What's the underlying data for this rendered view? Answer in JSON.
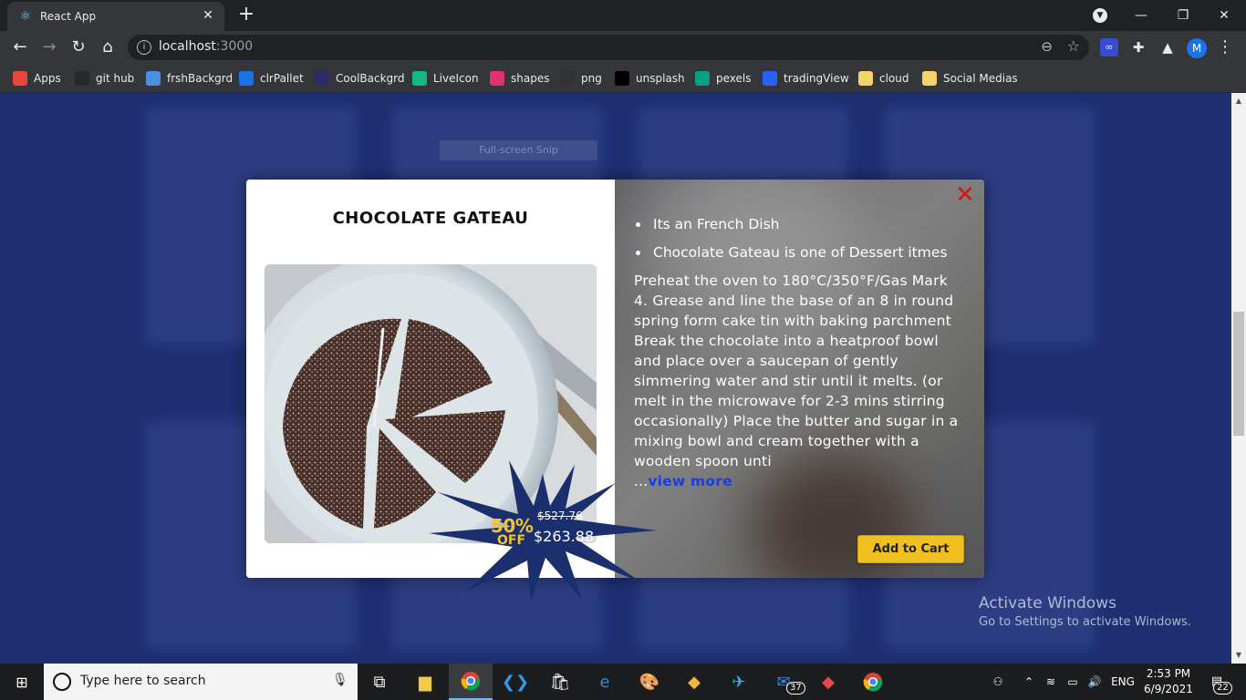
{
  "browser": {
    "tab_title": "React App",
    "tab_close": "✕",
    "new_tab": "+",
    "url_host": "localhost",
    "url_port": ":3000",
    "profile_initial": "M",
    "bookmarks": [
      {
        "label": "Apps",
        "icon": "apps-grid-icon",
        "color": "#e8453c"
      },
      {
        "label": "git hub",
        "icon": "github-icon",
        "color": "#24292e"
      },
      {
        "label": "frshBackgrd",
        "icon": "globe-icon",
        "color": "#4a90e2"
      },
      {
        "label": "clrPallet",
        "icon": "palette-icon",
        "color": "#1a73e8"
      },
      {
        "label": "CoolBackgrd",
        "icon": "coolbackgrounds-icon",
        "color": "#2a2e66"
      },
      {
        "label": "LiveIcon",
        "icon": "liveicon-icon",
        "color": "#12b886"
      },
      {
        "label": "shapes",
        "icon": "shapes-icon",
        "color": "#e03170"
      },
      {
        "label": "png",
        "icon": "png-icon",
        "color": "#333333"
      },
      {
        "label": "unsplash",
        "icon": "unsplash-icon",
        "color": "#000000"
      },
      {
        "label": "pexels",
        "icon": "pexels-icon",
        "color": "#05a081"
      },
      {
        "label": "tradingView",
        "icon": "tradingview-icon",
        "color": "#2962ff"
      },
      {
        "label": "cloud",
        "icon": "folder-icon",
        "color": "#f4d36b"
      },
      {
        "label": "Social Medias",
        "icon": "folder-icon",
        "color": "#f4d36b"
      }
    ]
  },
  "page": {
    "snip_label": "Full-screen Snip"
  },
  "modal": {
    "title": "CHOCOLATE GATEAU",
    "close_symbol": "✕",
    "bullets": [
      "Its an French Dish",
      "Chocolate Gateau is one of Dessert itmes"
    ],
    "recipe": "Preheat the oven to 180°C/350°F/Gas Mark 4. Grease and line the base of an 8 in round spring form cake tin with baking parchment Break the chocolate into a heatproof bowl and place over a saucepan of gently simmering water and stir until it melts. (or melt in the microwave for 2-3 mins stirring occasionally) Place the butter and sugar in a mixing bowl and cream together with a wooden spoon unti",
    "recipe_ellipsis": "...",
    "view_more": "view more",
    "add_to_cart": "Add to Cart",
    "discount_pct": "50%",
    "discount_off": "OFF",
    "old_price": "$527.76",
    "new_price": "$263.88"
  },
  "watermark": {
    "line1": "Activate Windows",
    "line2": "Go to Settings to activate Windows."
  },
  "taskbar": {
    "search_placeholder": "Type here to search",
    "mail_badge": "37",
    "language": "ENG",
    "time": "2:53 PM",
    "date": "6/9/2021",
    "notification_count": "22"
  },
  "colors": {
    "page_background": "#1e2f72",
    "add_to_cart": "#f0c020",
    "close_x": "#d01616",
    "view_more": "#1a3fe0",
    "sale_burst": "#1b2f6e",
    "sale_text": "#f3c22b"
  }
}
